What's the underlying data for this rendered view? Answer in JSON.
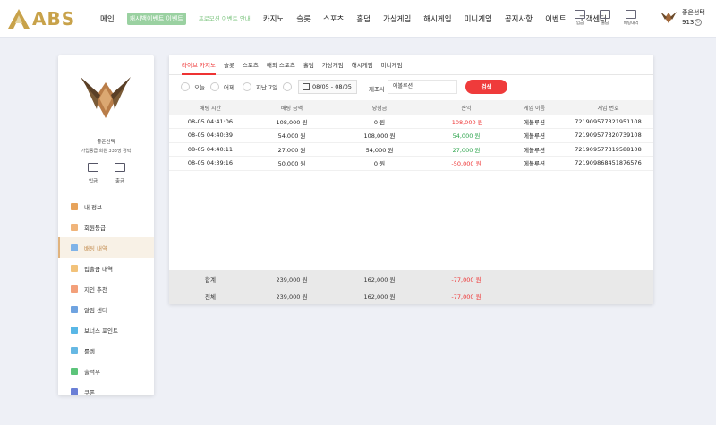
{
  "header": {
    "logo_text": "ABS",
    "nav": [
      {
        "label": "메인",
        "style": "normal"
      },
      {
        "label": "캐시백이벤트 이벤트",
        "style": "hl"
      },
      {
        "label": "프로모션 이벤트 안내",
        "style": "hl2"
      },
      {
        "label": "카지노",
        "style": "normal"
      },
      {
        "label": "슬롯",
        "style": "normal"
      },
      {
        "label": "스포츠",
        "style": "normal"
      },
      {
        "label": "홀덤",
        "style": "normal"
      },
      {
        "label": "가상게임",
        "style": "normal"
      },
      {
        "label": "해시게임",
        "style": "normal"
      },
      {
        "label": "미니게임",
        "style": "normal"
      },
      {
        "label": "공지사항",
        "style": "normal"
      },
      {
        "label": "이벤트",
        "style": "normal"
      },
      {
        "label": "고객센터",
        "style": "normal"
      }
    ],
    "icons": [
      {
        "label": "입금"
      },
      {
        "label": "출금"
      },
      {
        "label": "배팅내역"
      }
    ],
    "user": {
      "name": "좋은선택",
      "points": "913"
    }
  },
  "side": {
    "username": "좋은선택",
    "rank": "가입등급 회원 333명 경력",
    "deposit_label": "입금",
    "withdraw_label": "출금",
    "menu": [
      {
        "label": "내 정보",
        "color": "#e7a35b",
        "active": false
      },
      {
        "label": "회원등급",
        "color": "#f0b47a",
        "active": false
      },
      {
        "label": "배팅 내역",
        "color": "#7fb3e8",
        "active": true
      },
      {
        "label": "입출금 내역",
        "color": "#f2c27a",
        "active": false
      },
      {
        "label": "지인 추천",
        "color": "#f3a07a",
        "active": false
      },
      {
        "label": "알림 센터",
        "color": "#6fa3e0",
        "active": false
      },
      {
        "label": "보너스 포인트",
        "color": "#59b7e6",
        "active": false
      },
      {
        "label": "룰렛",
        "color": "#66b8e3",
        "active": false
      },
      {
        "label": "출석부",
        "color": "#5cc47a",
        "active": false
      },
      {
        "label": "쿠폰",
        "color": "#6a7fd6",
        "active": false
      }
    ]
  },
  "tabs": [
    "라이브 카지노",
    "슬롯",
    "스포츠",
    "해외 스포츠",
    "홀덤",
    "가상게임",
    "해시게임",
    "미니게임"
  ],
  "active_tab": 0,
  "filter": {
    "today": "오늘",
    "yesterday": "어제",
    "last7": "지난 7일",
    "date_range": "08/05 - 08/05",
    "provider_label": "제조사",
    "provider_value": "에볼루션",
    "search_label": "검색"
  },
  "table": {
    "headers": [
      "배팅 시간",
      "배팅 금액",
      "당첨금",
      "손익",
      "게임 이름",
      "게임 번호"
    ],
    "rows": [
      [
        "08-05 04:41:06",
        "108,000 원",
        "0 원",
        "-108,000 원",
        "에볼루션",
        "721909577321951108"
      ],
      [
        "08-05 04:40:39",
        "54,000 원",
        "108,000 원",
        "54,000 원",
        "에볼루션",
        "721909577320739108"
      ],
      [
        "08-05 04:40:11",
        "27,000 원",
        "54,000 원",
        "27,000 원",
        "에볼루션",
        "721909577319588108"
      ],
      [
        "08-05 04:39:16",
        "50,000 원",
        "0 원",
        "-50,000 원",
        "에볼루션",
        "721909868451876576"
      ]
    ],
    "row_colors": [
      "red",
      "green",
      "green",
      "red"
    ]
  },
  "summary": [
    {
      "label": "합계",
      "bet": "239,000 원",
      "win": "162,000 원",
      "pl": "-77,000 원"
    },
    {
      "label": "전체",
      "bet": "239,000 원",
      "win": "162,000 원",
      "pl": "-77,000 원"
    }
  ],
  "colors": {
    "accent": "#ef3b3b",
    "gold": "#c8a24a",
    "profit": "#2aa34a",
    "loss": "#e33"
  }
}
